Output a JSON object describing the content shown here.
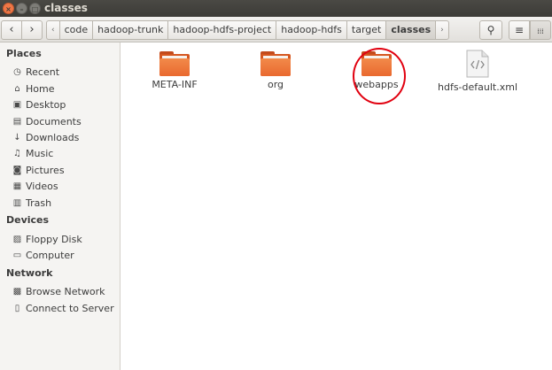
{
  "window": {
    "title": "classes",
    "close_glyph": "×",
    "minimize_glyph": "–",
    "maximize_glyph": "□"
  },
  "toolbar": {
    "back_glyph": "‹",
    "forward_glyph": "›",
    "breadcrumb_left_glyph": "‹",
    "breadcrumb_right_glyph": "›",
    "breadcrumbs": [
      "code",
      "hadoop-trunk",
      "hadoop-hdfs-project",
      "hadoop-hdfs",
      "target",
      "classes"
    ],
    "search_glyph": "⚲",
    "list_view_glyph": "≡",
    "grid_view_glyph": "⁞⁞⁞"
  },
  "sidebar": {
    "places_title": "Places",
    "places": [
      {
        "label": "Recent",
        "icon": "clock-icon",
        "glyph": "◷"
      },
      {
        "label": "Home",
        "icon": "home-icon",
        "glyph": "⌂"
      },
      {
        "label": "Desktop",
        "icon": "desktop-icon",
        "glyph": "▣"
      },
      {
        "label": "Documents",
        "icon": "documents-icon",
        "glyph": "▤"
      },
      {
        "label": "Downloads",
        "icon": "downloads-icon",
        "glyph": "↓"
      },
      {
        "label": "Music",
        "icon": "music-icon",
        "glyph": "♫"
      },
      {
        "label": "Pictures",
        "icon": "pictures-icon",
        "glyph": "◙"
      },
      {
        "label": "Videos",
        "icon": "videos-icon",
        "glyph": "▦"
      },
      {
        "label": "Trash",
        "icon": "trash-icon",
        "glyph": "▥"
      }
    ],
    "devices_title": "Devices",
    "devices": [
      {
        "label": "Floppy Disk",
        "icon": "floppy-icon",
        "glyph": "▨"
      },
      {
        "label": "Computer",
        "icon": "computer-icon",
        "glyph": "▭"
      }
    ],
    "network_title": "Network",
    "network": [
      {
        "label": "Browse Network",
        "icon": "network-icon",
        "glyph": "▩"
      },
      {
        "label": "Connect to Server",
        "icon": "server-icon",
        "glyph": "▯"
      }
    ]
  },
  "files": [
    {
      "name": "META-INF",
      "type": "folder"
    },
    {
      "name": "org",
      "type": "folder"
    },
    {
      "name": "webapps",
      "type": "folder"
    },
    {
      "name": "hdfs-default.xml",
      "type": "xml"
    }
  ],
  "colors": {
    "folder": "#e9692f",
    "highlight_circle": "#e1000f",
    "titlebar": "#3c3b37"
  }
}
